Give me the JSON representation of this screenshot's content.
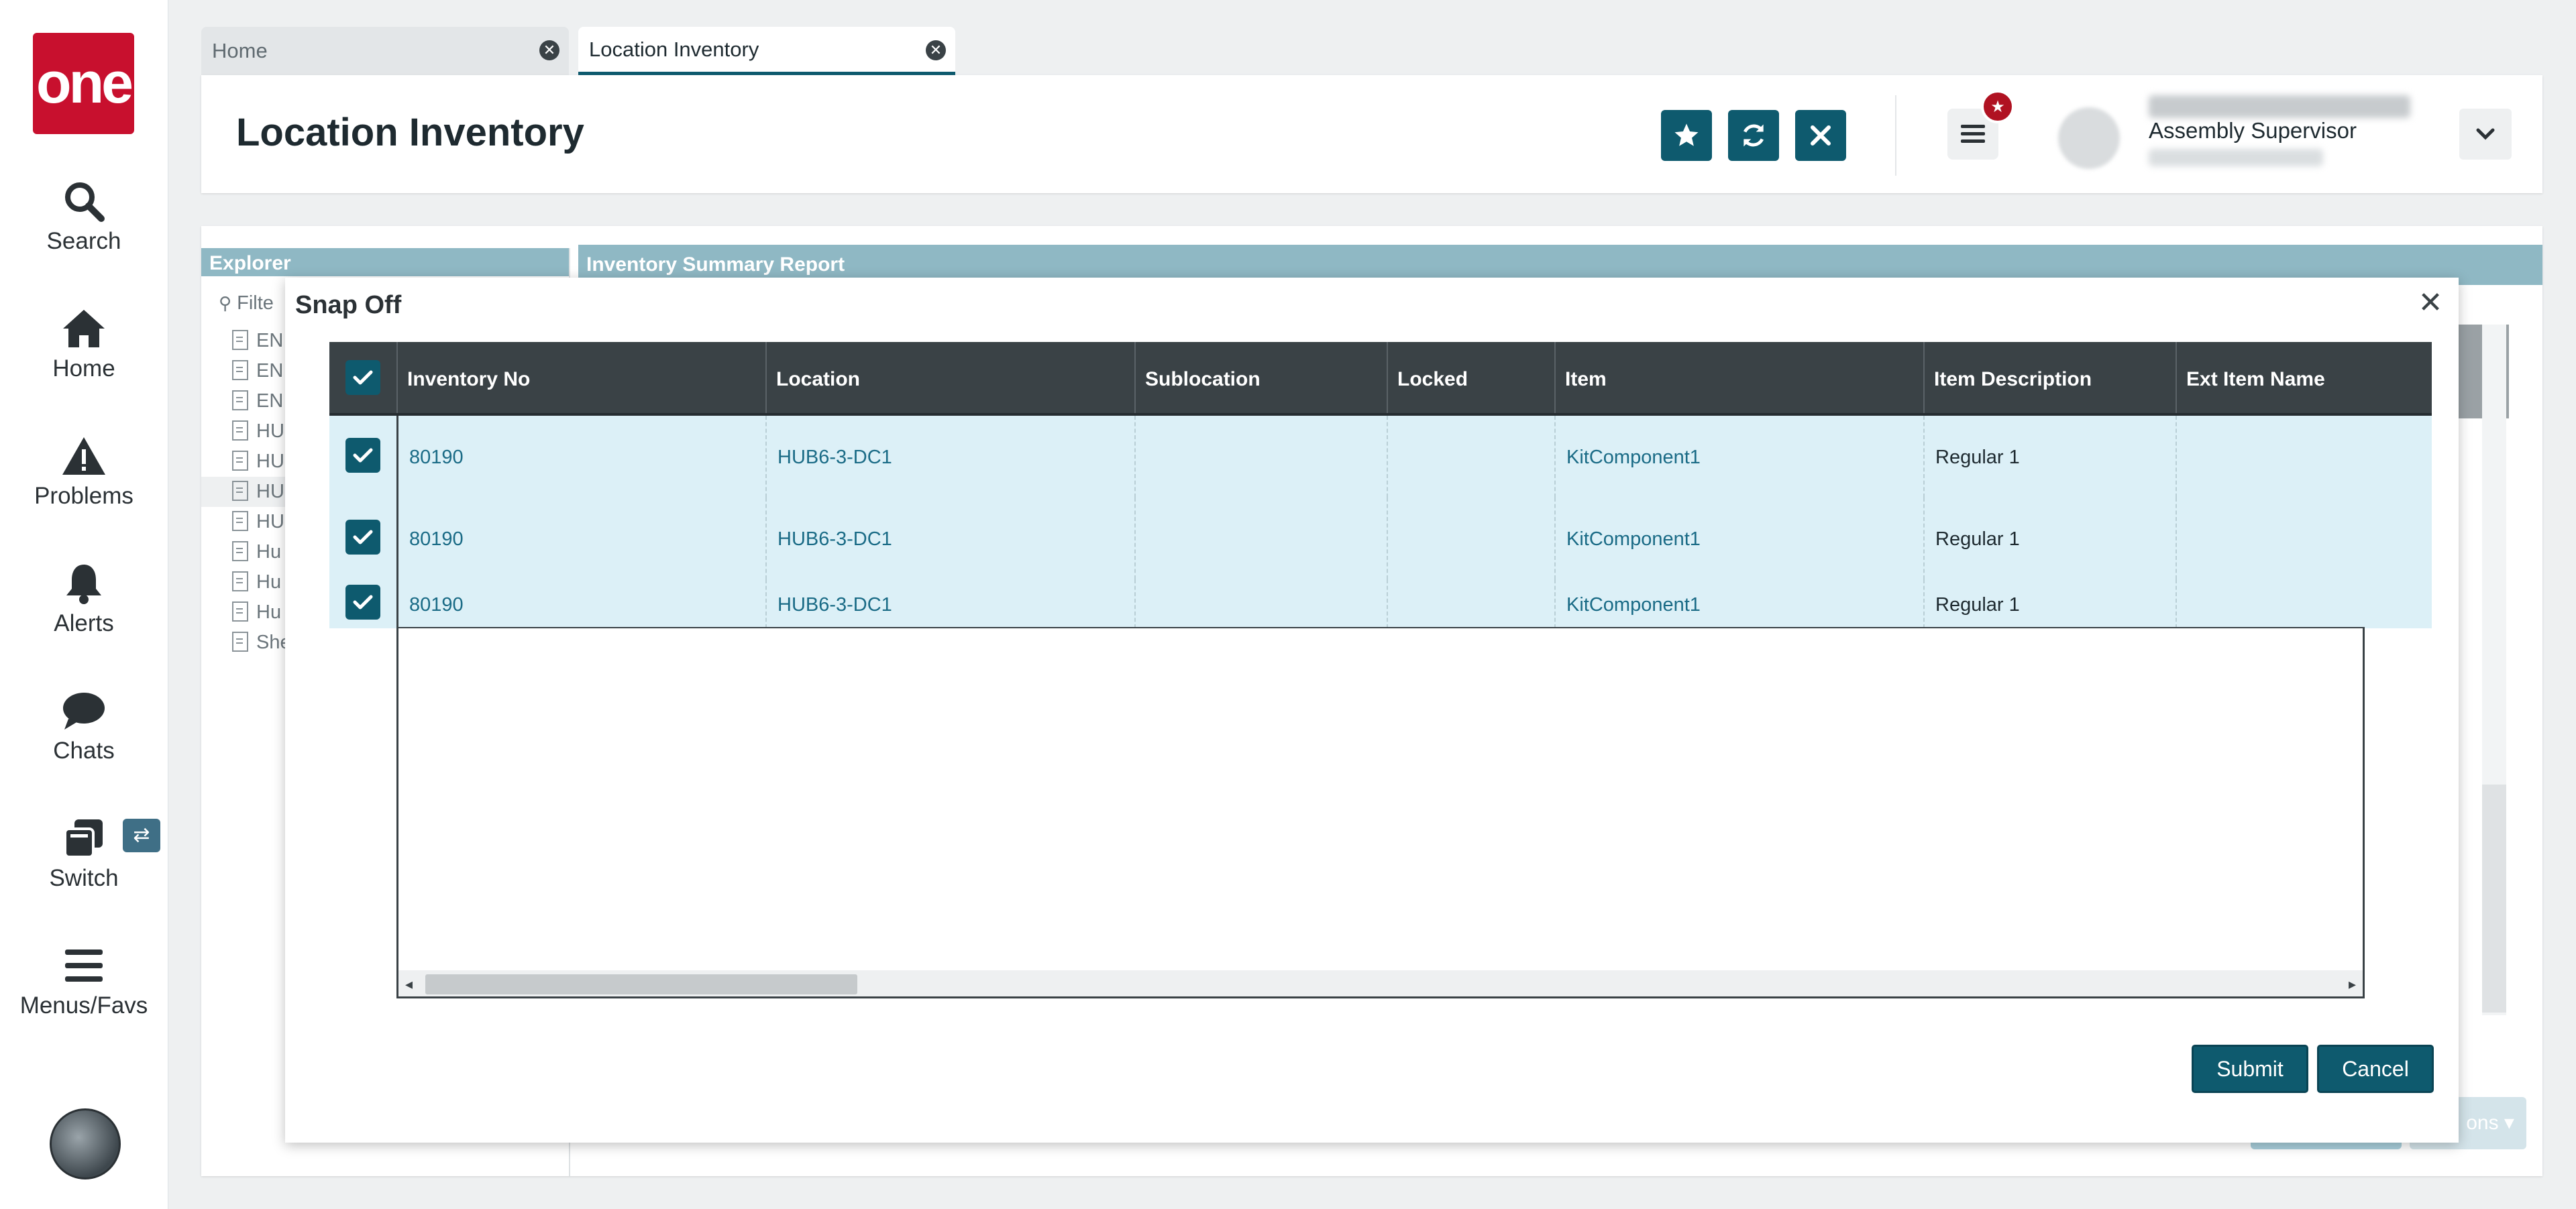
{
  "nav": {
    "logo_text": "one",
    "items": [
      {
        "label": "Search",
        "icon": "search-icon"
      },
      {
        "label": "Home",
        "icon": "home-icon"
      },
      {
        "label": "Problems",
        "icon": "warning-icon"
      },
      {
        "label": "Alerts",
        "icon": "bell-icon"
      },
      {
        "label": "Chats",
        "icon": "chat-icon"
      },
      {
        "label": "Switch",
        "icon": "switch-icon"
      },
      {
        "label": "Menus/Favs",
        "icon": "hamburger-icon"
      }
    ]
  },
  "tabs": [
    {
      "label": "Home",
      "active": false
    },
    {
      "label": "Location Inventory",
      "active": true
    }
  ],
  "header": {
    "title": "Location Inventory",
    "user_role": "Assembly Supervisor",
    "brand_color": "#0e5a6e",
    "badge_color": "#b01222"
  },
  "background": {
    "explorer_title": "Explorer",
    "filter_placeholder": "Filte",
    "tree_items": [
      "EN",
      "EN",
      "EN",
      "HU",
      "HU",
      "HU",
      "HU",
      "Hu",
      "Hu",
      "Hu",
      "She"
    ],
    "report_title": "Inventory Summary Report",
    "partial_button_text": "ons"
  },
  "modal": {
    "title": "Snap Off",
    "columns": [
      "Inventory No",
      "Location",
      "Sublocation",
      "Locked",
      "Item",
      "Item Description",
      "Ext Item Name"
    ],
    "rows": [
      {
        "inventory_no": "80190",
        "location": "HUB6-3-DC1",
        "sublocation": "",
        "locked": "",
        "item": "KitComponent1",
        "item_description": "Regular 1",
        "ext_item_name": "",
        "checked": true
      },
      {
        "inventory_no": "80190",
        "location": "HUB6-3-DC1",
        "sublocation": "",
        "locked": "",
        "item": "KitComponent1",
        "item_description": "Regular 1",
        "ext_item_name": "",
        "checked": true
      },
      {
        "inventory_no": "80190",
        "location": "HUB6-3-DC1",
        "sublocation": "",
        "locked": "",
        "item": "KitComponent1",
        "item_description": "Regular 1",
        "ext_item_name": "",
        "checked": true
      }
    ],
    "submit_label": "Submit",
    "cancel_label": "Cancel"
  }
}
